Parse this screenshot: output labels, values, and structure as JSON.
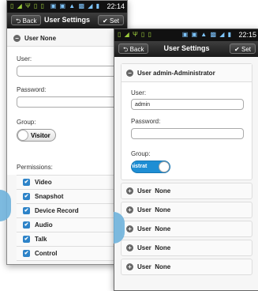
{
  "statusbar_back": {
    "time": "22:14",
    "glyphs": "▯ ◢ Ψ ▯ ▯",
    "sys": "▣ ▣ ▲ ▩ ◢ ▮"
  },
  "statusbar_front": {
    "time": "22:15",
    "glyphs": "▯ ◢ Ψ ▯ ▯",
    "sys": "▣ ▣ ▲ ▩ ◢ ▮"
  },
  "navbar": {
    "back_label": "Back",
    "title": "User Settings",
    "set_label": "Set",
    "back_arrow": "⮌",
    "set_check": "✔"
  },
  "back_screen": {
    "header": "User None",
    "user_label": "User:",
    "user_value": "",
    "password_label": "Password:",
    "group_label": "Group:",
    "group_value": "Visitor",
    "permissions_label": "Permissions:",
    "permissions": [
      "Video",
      "Snapshot",
      "Device Record",
      "Audio",
      "Talk",
      "Control"
    ]
  },
  "front_screen": {
    "header": "User admin-Administrator",
    "user_label": "User:",
    "user_value": "admin",
    "password_label": "Password:",
    "group_label": "Group:",
    "group_value": "inistrat",
    "users": [
      "User  None",
      "User  None",
      "User  None",
      "User  None",
      "User  None"
    ]
  },
  "colors": {
    "accent": "#2d83c8",
    "toggle_on": "#1e8ed4",
    "tab": "#6fb3dc"
  },
  "icons": {
    "collapse": "minus-circle-icon",
    "expand": "plus-circle-icon",
    "check": "check-icon"
  }
}
